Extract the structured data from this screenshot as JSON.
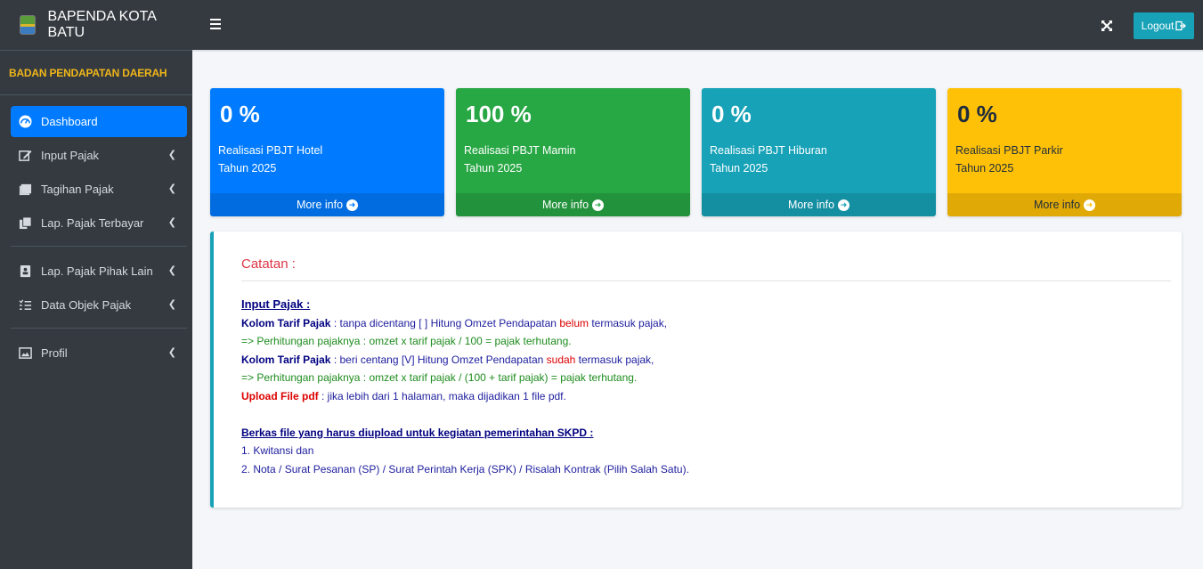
{
  "app": {
    "brand": "BAPENDA KOTA BATU",
    "org": "BADAN PENDAPATAN DAERAH",
    "logout_label": "Logout"
  },
  "sidebar": {
    "items": [
      {
        "label": "Dashboard",
        "icon": "dashboard-icon",
        "active": true
      },
      {
        "label": "Input Pajak",
        "icon": "edit-icon"
      },
      {
        "label": "Tagihan Pajak",
        "icon": "bill-icon"
      },
      {
        "label": "Lap. Pajak Terbayar",
        "icon": "copy-icon"
      },
      {
        "label": "Lap. Pajak Pihak Lain",
        "icon": "contact-icon"
      },
      {
        "label": "Data Objek Pajak",
        "icon": "list-icon"
      },
      {
        "label": "Profil",
        "icon": "image-icon"
      }
    ]
  },
  "boxes": [
    {
      "value": "0 %",
      "line1": "Realisasi PBJT Hotel",
      "line2": "Tahun 2025",
      "footer": "More info",
      "color": "#007bff"
    },
    {
      "value": "100 %",
      "line1": "Realisasi PBJT Mamin",
      "line2": "Tahun 2025",
      "footer": "More info",
      "color": "#28a745"
    },
    {
      "value": "0 %",
      "line1": "Realisasi PBJT Hiburan",
      "line2": "Tahun 2025",
      "footer": "More info",
      "color": "#17a2b8"
    },
    {
      "value": "0 %",
      "line1": "Realisasi PBJT Parkir",
      "line2": "Tahun 2025",
      "footer": "More info",
      "color": "#ffc107"
    }
  ],
  "note": {
    "title": "Catatan :",
    "section1_heading": "Input Pajak :",
    "l1_bold": "Kolom Tarif Pajak",
    "l1_a": " : tanpa dicentang [ ] Hitung Omzet Pendapatan ",
    "l1_red": "belum",
    "l1_b": " termasuk pajak,",
    "l2": "=> Perhitungan pajaknya : omzet x tarif pajak / 100 = pajak terhutang.",
    "l3_bold": "Kolom Tarif Pajak",
    "l3_a": " : beri centang [V] Hitung Omzet Pendapatan ",
    "l3_red": "sudah",
    "l3_b": " termasuk pajak,",
    "l4": "=> Perhitungan pajaknya : omzet x tarif pajak / (100 + tarif pajak) = pajak terhutang.",
    "l5_bold": "Upload File pdf",
    "l5_a": " : jika lebih dari 1 halaman, maka dijadikan 1 file pdf.",
    "section2_heading": "Berkas file yang harus diupload untuk kegiatan pemerintahan SKPD :",
    "item1": "1. Kwitansi dan",
    "item2": "2. Nota / Surat Pesanan (SP) / Surat Perintah Kerja (SPK) / Risalah Kontrak (Pilih Salah Satu)."
  }
}
